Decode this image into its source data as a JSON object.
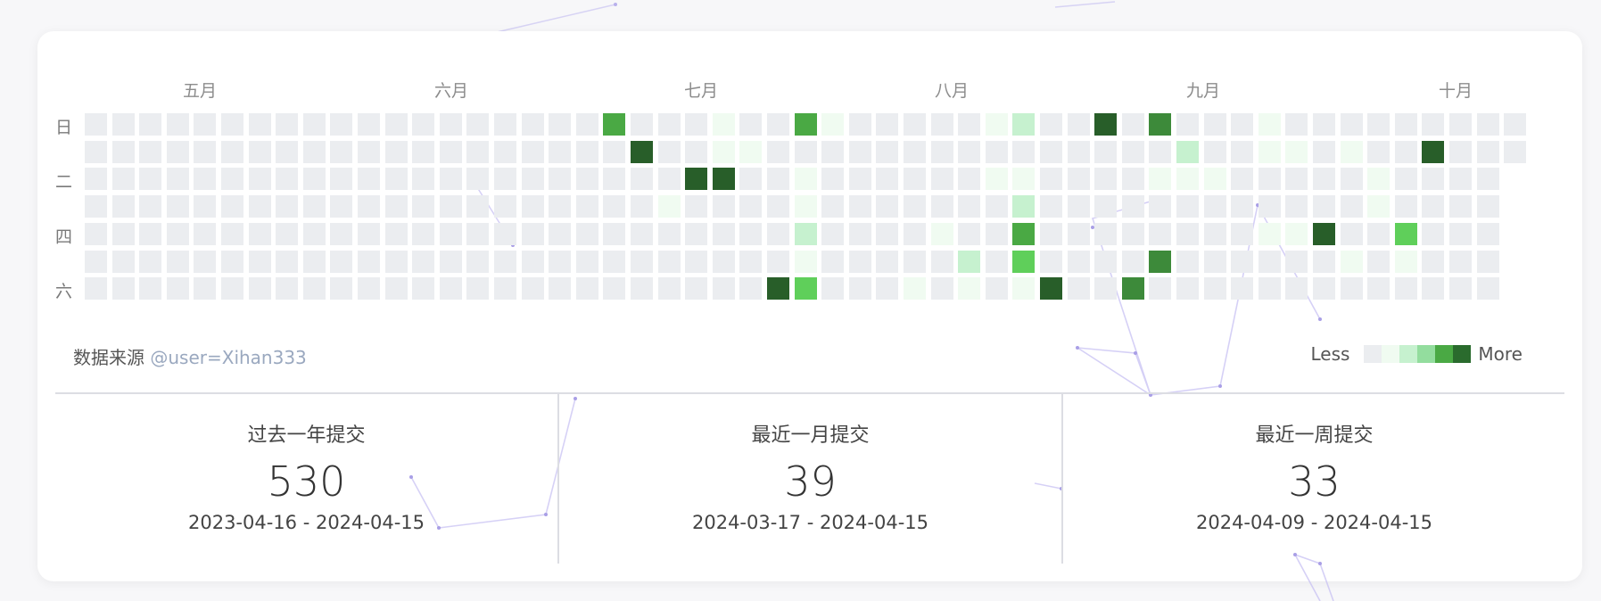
{
  "months": [
    "五月",
    "六月",
    "七月",
    "八月",
    "九月",
    "十月"
  ],
  "day_labels": [
    "日",
    "二",
    "四",
    "六"
  ],
  "source": {
    "label": "数据来源",
    "handle": "@user=Xihan333"
  },
  "legend": {
    "less": "Less",
    "more": "More",
    "colors": [
      "#ebedf0",
      "#f0fbf1",
      "#c6f1cf",
      "#93dd9e",
      "#4aa944",
      "#2a6b2d"
    ]
  },
  "stats": [
    {
      "title": "过去一年提交",
      "value": "530",
      "range": "2023-04-16 - 2024-04-15"
    },
    {
      "title": "最近一月提交",
      "value": "39",
      "range": "2024-03-17 - 2024-04-15"
    },
    {
      "title": "最近一周提交",
      "value": "33",
      "range": "2024-04-09 - 2024-04-15"
    }
  ],
  "heatmap": {
    "weeks": 53,
    "last_week_days": 2,
    "palette": [
      "#ebedf0",
      "#f0fbf1",
      "#c6f1cf",
      "#5fcf5a",
      "#4aa944",
      "#3d8a3a",
      "#285e29"
    ],
    "cells": [
      [
        19,
        0,
        4
      ],
      [
        20,
        1,
        6
      ],
      [
        22,
        2,
        6
      ],
      [
        23,
        2,
        6
      ],
      [
        25,
        6,
        6
      ],
      [
        23,
        0,
        1
      ],
      [
        24,
        1,
        1
      ],
      [
        26,
        0,
        4
      ],
      [
        27,
        0,
        1
      ],
      [
        26,
        3,
        1
      ],
      [
        26,
        4,
        2
      ],
      [
        26,
        6,
        3
      ],
      [
        26,
        5,
        1
      ],
      [
        24,
        0,
        0
      ],
      [
        21,
        3,
        1
      ],
      [
        26,
        2,
        1
      ],
      [
        23,
        1,
        1
      ],
      [
        22,
        0,
        0
      ],
      [
        25,
        3,
        0
      ],
      [
        27,
        6,
        0
      ],
      [
        30,
        6,
        1
      ],
      [
        31,
        4,
        1
      ],
      [
        32,
        5,
        2
      ],
      [
        32,
        6,
        1
      ],
      [
        33,
        0,
        1
      ],
      [
        34,
        0,
        2
      ],
      [
        34,
        3,
        2
      ],
      [
        34,
        4,
        4
      ],
      [
        34,
        5,
        3
      ],
      [
        34,
        6,
        1
      ],
      [
        35,
        0,
        0
      ],
      [
        35,
        4,
        0
      ],
      [
        35,
        6,
        6
      ],
      [
        36,
        0,
        0
      ],
      [
        37,
        0,
        6
      ],
      [
        38,
        6,
        5
      ],
      [
        39,
        0,
        5
      ],
      [
        39,
        5,
        5
      ],
      [
        40,
        1,
        2
      ],
      [
        40,
        2,
        1
      ],
      [
        42,
        0,
        0
      ],
      [
        43,
        0,
        1
      ],
      [
        43,
        1,
        1
      ],
      [
        44,
        1,
        1
      ],
      [
        45,
        4,
        6
      ],
      [
        46,
        1,
        1
      ],
      [
        47,
        2,
        1
      ],
      [
        48,
        4,
        3
      ],
      [
        49,
        1,
        6
      ],
      [
        33,
        2,
        1
      ],
      [
        34,
        2,
        1
      ],
      [
        39,
        2,
        1
      ],
      [
        40,
        3,
        0
      ],
      [
        41,
        2,
        1
      ],
      [
        42,
        3,
        0
      ],
      [
        43,
        4,
        1
      ],
      [
        44,
        4,
        1
      ],
      [
        46,
        5,
        1
      ],
      [
        47,
        3,
        1
      ],
      [
        48,
        5,
        1
      ]
    ]
  }
}
